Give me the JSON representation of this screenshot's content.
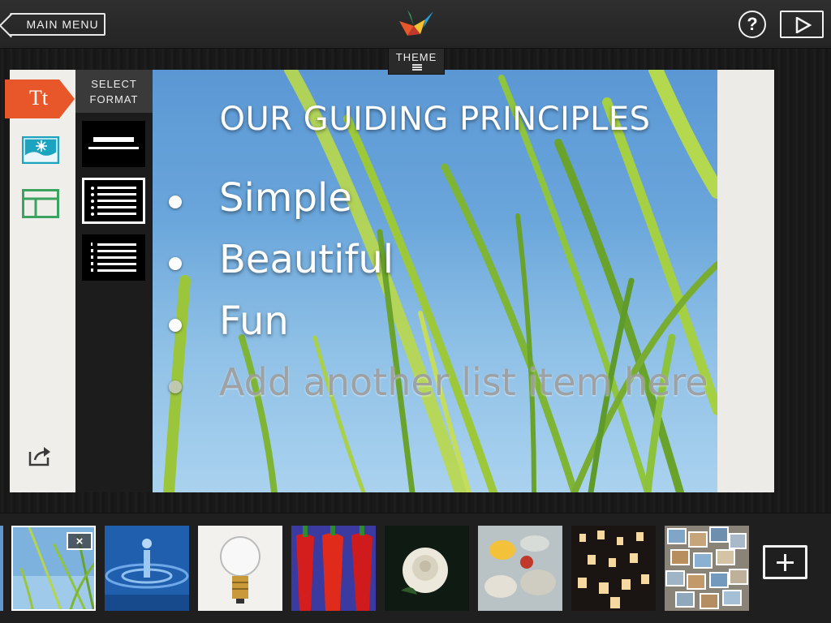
{
  "header": {
    "main_menu_label": "MAIN MENU",
    "help_label": "?",
    "theme_label": "THEME"
  },
  "tools": {
    "text_tool_label": "Tt",
    "image_tool_icon": "image-icon",
    "layout_tool_icon": "layout-icon",
    "share_icon": "share-icon"
  },
  "format_panel": {
    "title_line1": "SELECT",
    "title_line2": "FORMAT",
    "options": [
      "heading-format",
      "bullet-list-format",
      "numbered-list-format"
    ],
    "selected": "bullet-list-format"
  },
  "slide": {
    "title": "OUR GUIDING PRINCIPLES",
    "items": [
      "Simple",
      "Beautiful",
      "Fun"
    ],
    "placeholder_item": "Add another list item here"
  },
  "filmstrip": {
    "thumbnails": [
      "grass",
      "water-drop",
      "light-bulb",
      "red-peppers",
      "white-rose",
      "oysters",
      "sky-lanterns",
      "photo-collage"
    ],
    "selected": "grass",
    "delete_label": "×",
    "add_label": "+"
  },
  "colors": {
    "accent": "#e8572a",
    "image_tool": "#1ba3bf",
    "layout_tool": "#3aa35f"
  }
}
